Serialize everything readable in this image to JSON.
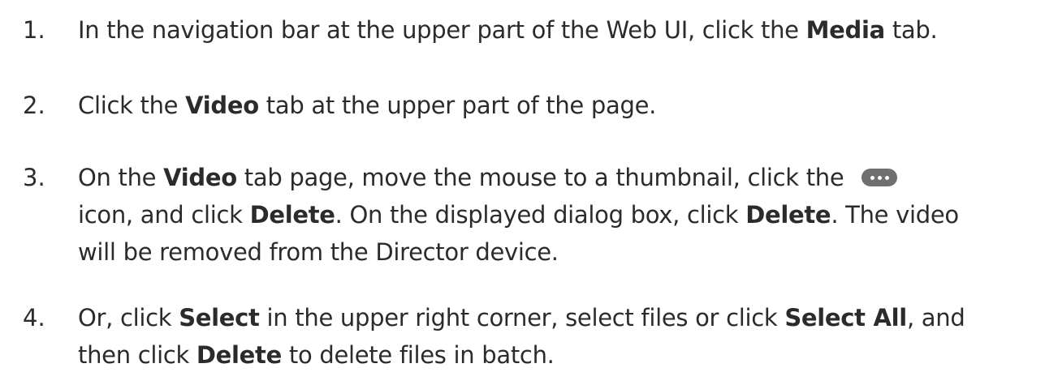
{
  "steps": [
    {
      "number": "1.",
      "lines": [
        {
          "a": "In the navigation bar at the upper part of the Web UI, click the ",
          "b": "Media",
          "c": " tab."
        }
      ]
    },
    {
      "number": "2.",
      "lines": [
        {
          "a": "Click the ",
          "b": "Video",
          "c": " tab at the upper part of the page."
        }
      ]
    },
    {
      "number": "3.",
      "lines": [
        {
          "a": "On the ",
          "b": "Video",
          "c": " tab page, move the mouse to a thumbnail, click the"
        },
        {
          "a": "icon, and click ",
          "b": "Delete",
          "c": ". On the displayed dialog box, click ",
          "d": "Delete",
          "e": ". The video"
        },
        {
          "a": "will be removed from the Director device."
        }
      ],
      "icon": "more-options-icon"
    },
    {
      "number": "4.",
      "lines": [
        {
          "a": "Or, click ",
          "b": "Select",
          "c": " in the upper right corner, select files or click ",
          "d": "Select All",
          "e": ", and"
        },
        {
          "a": "then click ",
          "b": "Delete",
          "c": " to delete files in batch."
        }
      ]
    }
  ]
}
